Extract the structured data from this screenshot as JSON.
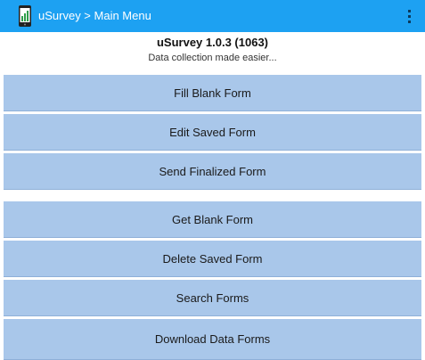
{
  "app_bar": {
    "title": "uSurvey > Main Menu",
    "icon": "phone-bar-chart-icon",
    "menu_icon": "overflow-menu-icon",
    "color": "#1da1f2"
  },
  "header": {
    "version": "uSurvey 1.0.3 (1063)",
    "tagline": "Data collection made easier..."
  },
  "menu": {
    "button_color": "#a9c7ea",
    "items": [
      {
        "label": "Fill Blank Form"
      },
      {
        "label": "Edit Saved Form"
      },
      {
        "label": "Send Finalized Form"
      },
      {
        "label": "Get Blank Form"
      },
      {
        "label": "Delete Saved Form"
      },
      {
        "label": "Search Forms"
      },
      {
        "label": "Download Data Forms"
      }
    ]
  }
}
